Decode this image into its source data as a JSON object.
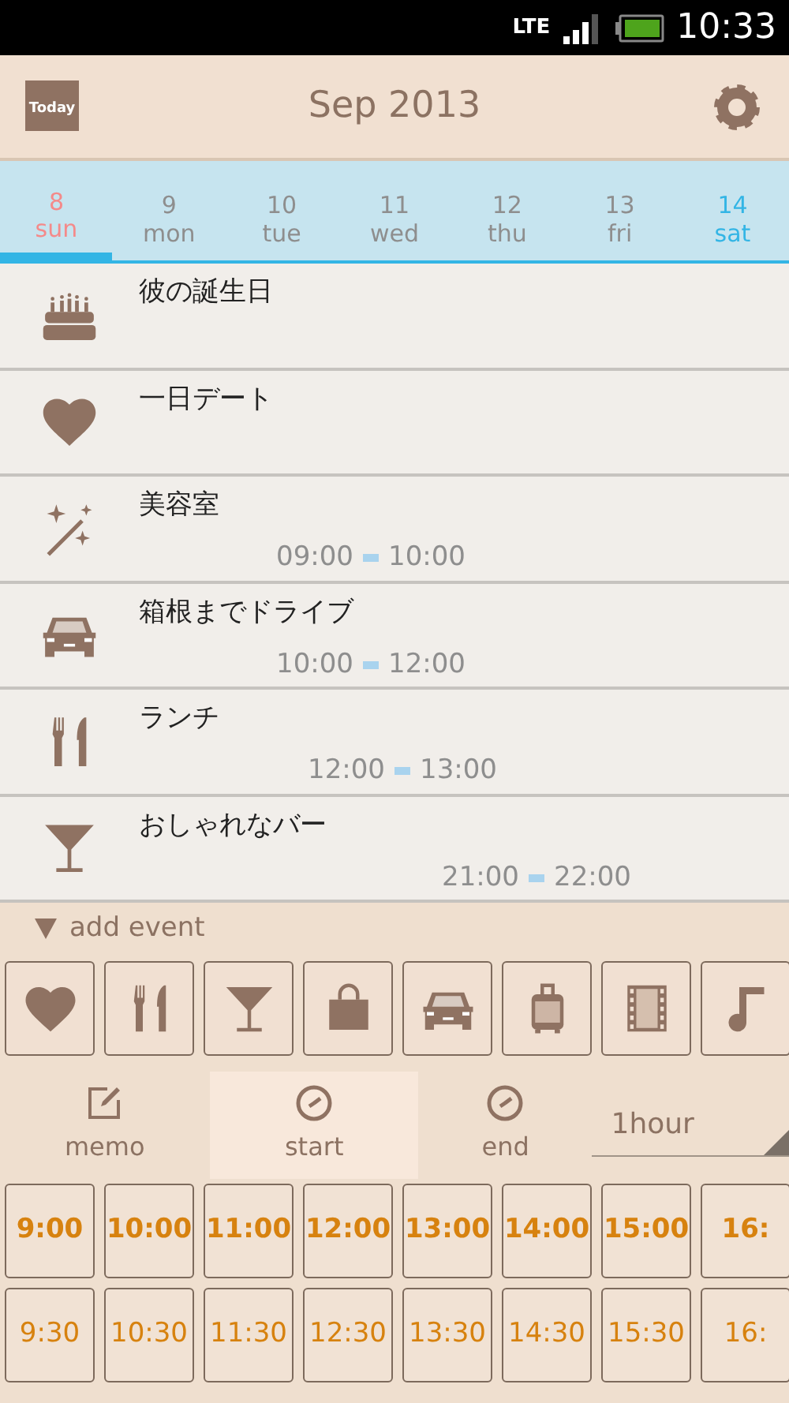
{
  "status_bar": {
    "network": "LTE",
    "time": "10:33"
  },
  "header": {
    "today_label": "Today",
    "title": "Sep 2013"
  },
  "days": [
    {
      "date": "8",
      "weekday": "sun",
      "selected": true,
      "color": "#f48a8a"
    },
    {
      "date": "9",
      "weekday": "mon",
      "selected": false,
      "color": "#8e8e8e"
    },
    {
      "date": "10",
      "weekday": "tue",
      "selected": false,
      "color": "#8e8e8e"
    },
    {
      "date": "11",
      "weekday": "wed",
      "selected": false,
      "color": "#8e8e8e"
    },
    {
      "date": "12",
      "weekday": "thu",
      "selected": false,
      "color": "#8e8e8e"
    },
    {
      "date": "13",
      "weekday": "fri",
      "selected": false,
      "color": "#8e8e8e"
    },
    {
      "date": "14",
      "weekday": "sat",
      "selected": false,
      "color": "#33b5e5"
    }
  ],
  "events": [
    {
      "kind": "cake",
      "title": "彼の誕生日"
    },
    {
      "kind": "heart",
      "title": "一日デート"
    },
    {
      "kind": "wand",
      "title": "美容室",
      "start": "09:00",
      "end": "10:00"
    },
    {
      "kind": "car",
      "title": "箱根までドライブ",
      "start": "10:00",
      "end": "12:00"
    },
    {
      "kind": "utensils",
      "title": "ランチ",
      "start": "12:00",
      "end": "13:00"
    },
    {
      "kind": "cocktail",
      "title": "おしゃれなバー",
      "start": "21:00",
      "end": "22:00"
    }
  ],
  "add_event": {
    "label": "add event"
  },
  "quick_icons": [
    {
      "kind": "heart"
    },
    {
      "kind": "utensils"
    },
    {
      "kind": "cocktail"
    },
    {
      "kind": "bag"
    },
    {
      "kind": "car"
    },
    {
      "kind": "suitcase"
    },
    {
      "kind": "film"
    },
    {
      "kind": "music"
    }
  ],
  "modes": [
    {
      "kind": "memo",
      "label": "memo",
      "selected": false
    },
    {
      "kind": "clock",
      "label": "start",
      "selected": true
    },
    {
      "kind": "clock",
      "label": "end",
      "selected": false
    }
  ],
  "duration": {
    "value": "1hour"
  },
  "time_rows": [
    [
      "9:00",
      "10:00",
      "11:00",
      "12:00",
      "13:00",
      "14:00",
      "15:00",
      "16:"
    ],
    [
      "9:30",
      "10:30",
      "11:30",
      "12:30",
      "13:30",
      "14:30",
      "15:30",
      "16:"
    ]
  ]
}
